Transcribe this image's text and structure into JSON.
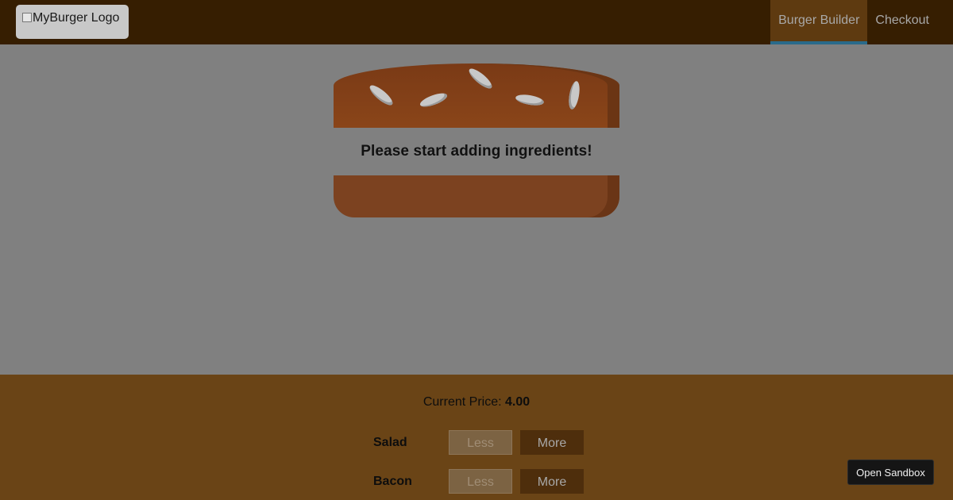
{
  "toolbar": {
    "logo_alt": "MyBurger Logo",
    "nav_items": [
      {
        "label": "Burger Builder",
        "active": true
      },
      {
        "label": "Checkout",
        "active": false
      }
    ]
  },
  "burger": {
    "message": "Please start adding ingredients!"
  },
  "build_controls": {
    "price_label": "Current Price:",
    "price_value": "4.00",
    "controls": [
      {
        "label": "Salad",
        "less_label": "Less",
        "more_label": "More",
        "less_disabled": true
      },
      {
        "label": "Bacon",
        "less_label": "Less",
        "more_label": "More",
        "less_disabled": true
      }
    ]
  },
  "sandbox_button": "Open Sandbox",
  "colors": {
    "overlay_bg": "#808080",
    "toolbar_bg": "#361e01",
    "controls_bg": "#6a4416",
    "more_button_bg": "#4e2e0c",
    "active_nav_border": "#2a6a8a"
  }
}
